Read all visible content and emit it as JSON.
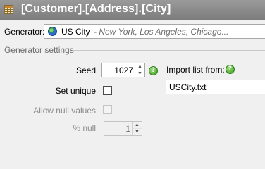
{
  "window": {
    "title": "[Customer].[Address].[City]",
    "icon": "table-icon"
  },
  "generator": {
    "label": "Generator:",
    "value": "US City",
    "examples": "- New York, Los Angeles, Chicago...",
    "icon": "globe-icon"
  },
  "settings": {
    "header": "Generator settings",
    "seed": {
      "label": "Seed",
      "value": "1027"
    },
    "set_unique": {
      "label": "Set unique",
      "checked": false
    },
    "allow_null": {
      "label": "Allow null values",
      "checked": false,
      "enabled": false
    },
    "pct_null": {
      "label": "% null",
      "value": "1",
      "enabled": false
    },
    "import": {
      "label": "Import list from:",
      "value": "USCity.txt"
    }
  },
  "icons": {
    "help": "?",
    "spin_up": "▲",
    "spin_down": "▼"
  },
  "colors": {
    "title_bar": "#8a8a8a",
    "title_text": "#ffffff",
    "help_green": "#3c9a1e"
  }
}
